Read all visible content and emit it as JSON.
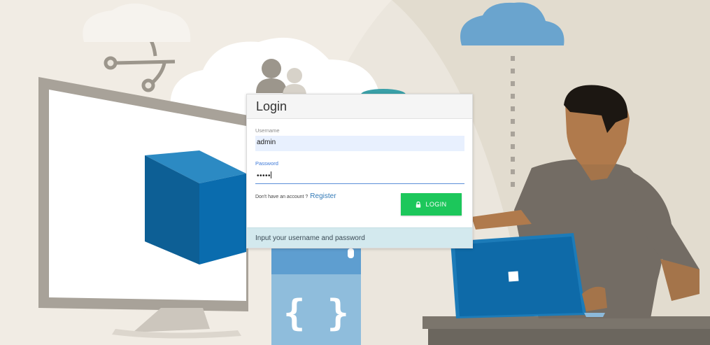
{
  "colors": {
    "background": "#ebe6dd",
    "cube_front": "#0a67a3",
    "cloud_blue": "#6aa4ce",
    "login_button": "#1cc75b",
    "footer_bg": "#d3e9ee"
  },
  "login": {
    "title": "Login",
    "username_label": "Username",
    "username_value": "admin",
    "password_label": "Password",
    "password_value": "•••••",
    "register_prompt": "Don't have an account ?",
    "register_link": "Register",
    "button_icon": "lock-icon",
    "button_label": "LOGIN",
    "hint": "Input your username and password"
  },
  "illustration": {
    "code_braces": "{ }"
  }
}
